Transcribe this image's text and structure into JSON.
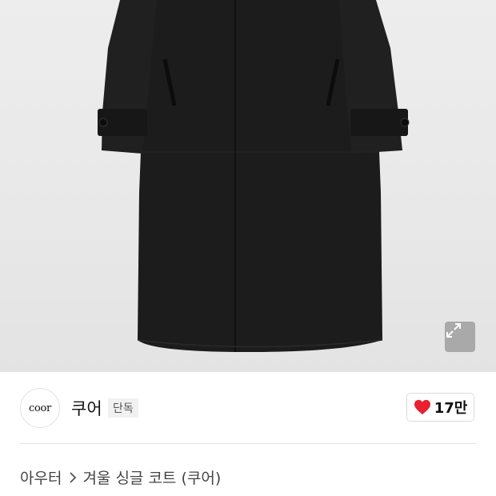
{
  "product": {
    "image_alt": "black single coat"
  },
  "zoom": {
    "icon": "expand-icon"
  },
  "brand": {
    "logo_text": "coor",
    "name": "쿠어",
    "badge": "단독"
  },
  "like": {
    "icon": "heart-icon",
    "count": "17만",
    "color": "#e8202f"
  },
  "breadcrumb": {
    "category": "아우터",
    "separator_icon": "chevron-right-icon",
    "product_name": "겨울 싱글 코트 (쿠어)"
  }
}
